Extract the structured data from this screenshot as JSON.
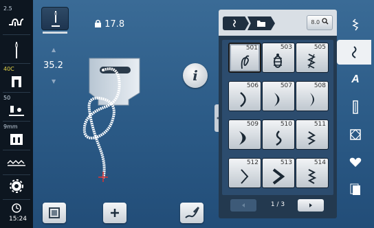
{
  "left_sidebar": {
    "stitch_width_hint": "2.5",
    "thread_tension_label": "40C",
    "stitch_length_hint": "50",
    "feed_dog_label": "9mm",
    "time": "15:24"
  },
  "top": {
    "stitch_length_value": "17.8",
    "stitch_width_value": "35.2"
  },
  "info_button": {
    "label": "i"
  },
  "panel": {
    "search_label": "8.0",
    "stitches": [
      {
        "number": "501",
        "glyph": "loop-icon",
        "selected": true
      },
      {
        "number": "503",
        "glyph": "bug-icon",
        "selected": false
      },
      {
        "number": "505",
        "glyph": "zigzag-arrow-icon",
        "selected": false
      },
      {
        "number": "506",
        "glyph": "crescent-icon",
        "selected": false
      },
      {
        "number": "507",
        "glyph": "crescent-icon",
        "selected": false
      },
      {
        "number": "508",
        "glyph": "crescent-icon",
        "selected": false
      },
      {
        "number": "509",
        "glyph": "thick-crescent-icon",
        "selected": false
      },
      {
        "number": "510",
        "glyph": "wave-icon",
        "selected": false
      },
      {
        "number": "511",
        "glyph": "zigzag-icon",
        "selected": false
      },
      {
        "number": "512",
        "glyph": "chevron-icon",
        "selected": false
      },
      {
        "number": "513",
        "glyph": "thick-chevron-icon",
        "selected": false
      },
      {
        "number": "514",
        "glyph": "zigzag-chevron-icon",
        "selected": false
      }
    ],
    "page_indicator": "1 / 3"
  }
}
